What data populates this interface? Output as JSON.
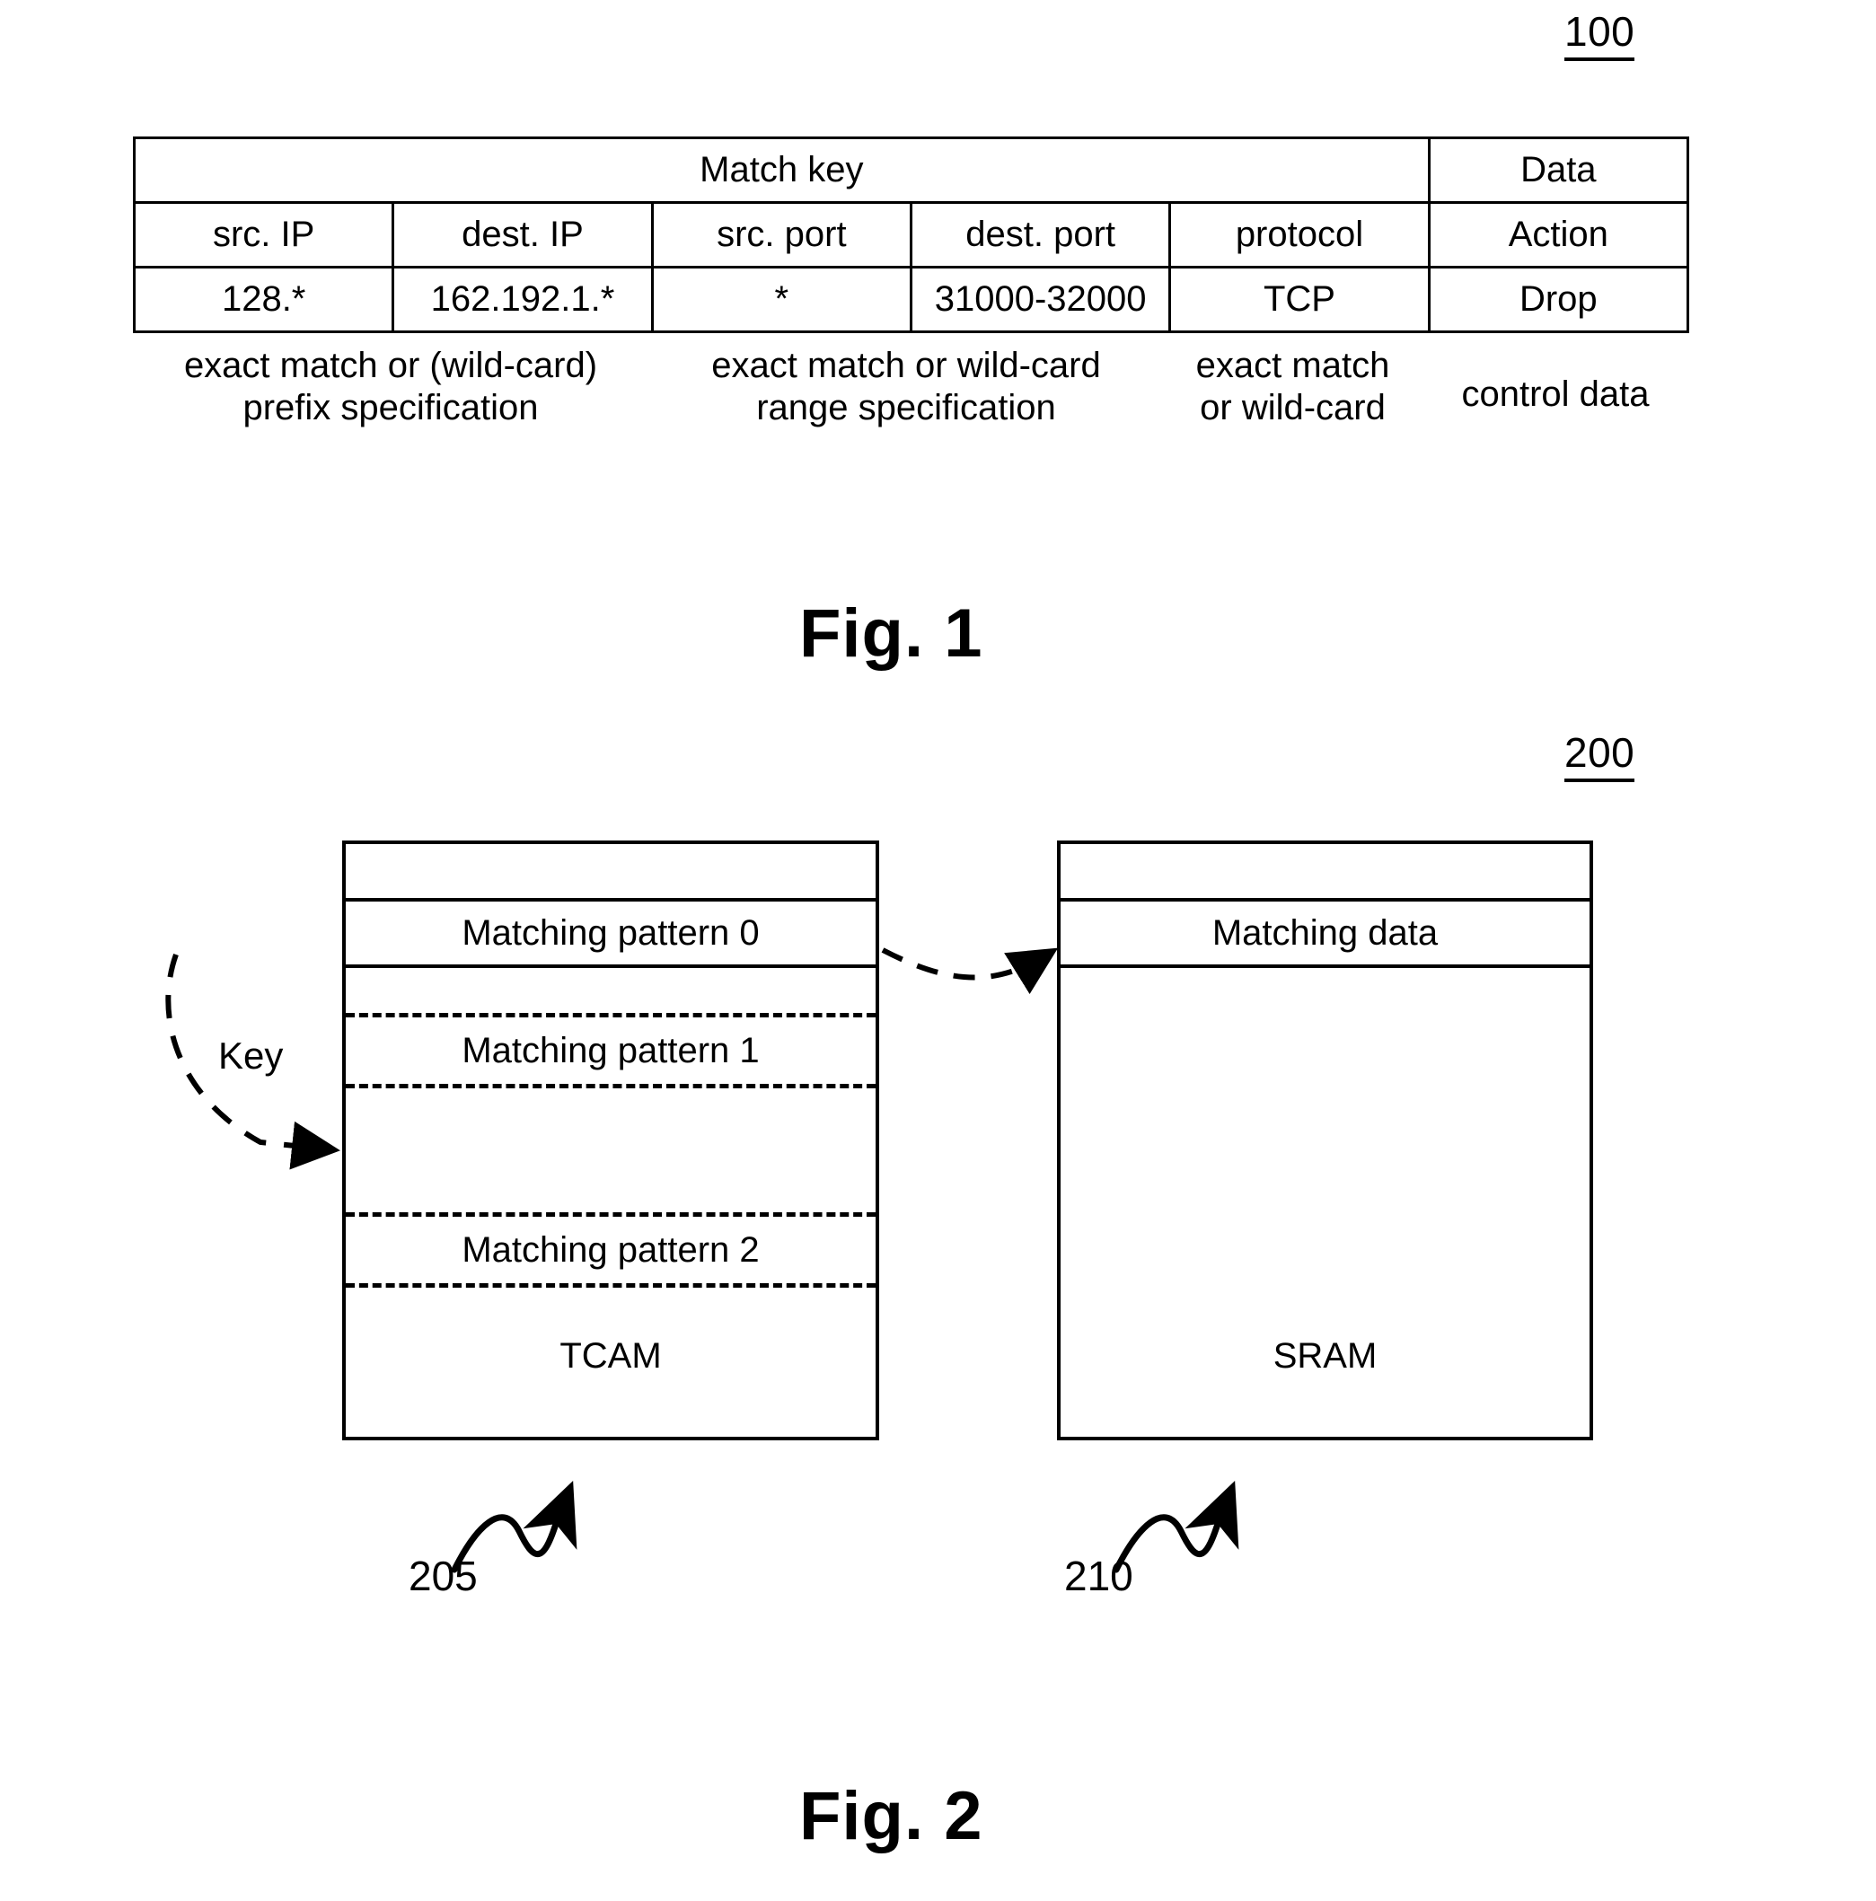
{
  "figure1": {
    "ref_number": "100",
    "caption": "Fig. 1",
    "table": {
      "group_headers": [
        {
          "label": "Match key",
          "span": 5
        },
        {
          "label": "Data",
          "span": 1
        }
      ],
      "column_headers": [
        "src. IP",
        "dest. IP",
        "src. port",
        "dest. port",
        "protocol",
        "Action"
      ],
      "rows": [
        [
          "128.*",
          "162.192.1.*",
          "*",
          "31000-32000",
          "TCP",
          "Drop"
        ]
      ]
    },
    "annotations": [
      "exact match or (wild-card) prefix specification",
      "exact match or wild-card range specification",
      "exact match or wild-card",
      "control data"
    ],
    "annotation_lines": {
      "prefix_line1": "exact match or (wild-card)",
      "prefix_line2": "prefix specification",
      "range_line1": "exact match or wild-card",
      "range_line2": "range specification",
      "proto_line1": "exact match",
      "proto_line2": "or wild-card",
      "control_line1": "control data"
    }
  },
  "figure2": {
    "ref_number": "200",
    "caption": "Fig. 2",
    "key_label": "Key",
    "tcam": {
      "name": "TCAM",
      "ref_number": "205",
      "entries": [
        "Matching pattern 0",
        "Matching pattern 1",
        "Matching pattern 2"
      ]
    },
    "sram": {
      "name": "SRAM",
      "ref_number": "210",
      "entries": [
        "Matching data"
      ]
    }
  },
  "colors": {
    "stroke": "#000000",
    "background": "#ffffff"
  }
}
